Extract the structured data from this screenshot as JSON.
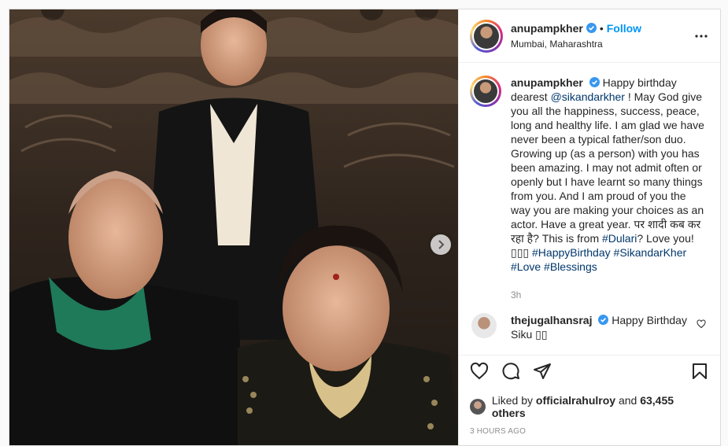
{
  "post": {
    "username": "anupampkher",
    "follow_label": "Follow",
    "location": "Mumbai, Maharashtra",
    "caption_user": "anupampkher",
    "caption_pre": "Happy birthday dearest",
    "caption_mention": "@sikandarkher",
    "caption_body": "! May God give you all the happiness, success, peace, long and healthy life. I am glad we have never been a typical father/son duo. Growing up (as a person) with you has been amazing. I may not admit often or openly but I have learnt so many things from you. And I am proud of you the way you are making your choices as an actor. Have a great year. पर शादी कब कर रहा है? This is from",
    "caption_tag_dulari": "#Dulari",
    "caption_tail": "? Love you! ▯▯▯",
    "hashtags": [
      "#HappyBirthday",
      "#SikandarKher",
      "#Love",
      "#Blessings"
    ],
    "caption_time": "3h",
    "comment_user": "thejugalhansraj",
    "comment_text": "Happy Birthday Siku ▯▯",
    "liked_by_prefix": "Liked by",
    "liked_by_user": "officialrahulroy",
    "liked_by_and": "and",
    "liked_by_count": "63,455 others",
    "timestamp": "3 HOURS AGO"
  },
  "icons": {
    "verified": "verified-badge-icon",
    "more": "more-options-icon",
    "next": "chevron-right-icon",
    "like": "heart-icon",
    "comment": "comment-bubble-icon",
    "share": "paper-plane-icon",
    "save": "bookmark-icon"
  },
  "colors": {
    "link": "#0095f6",
    "tag": "#00376b",
    "muted": "#8e8e8e",
    "verified": "#3897f0"
  }
}
